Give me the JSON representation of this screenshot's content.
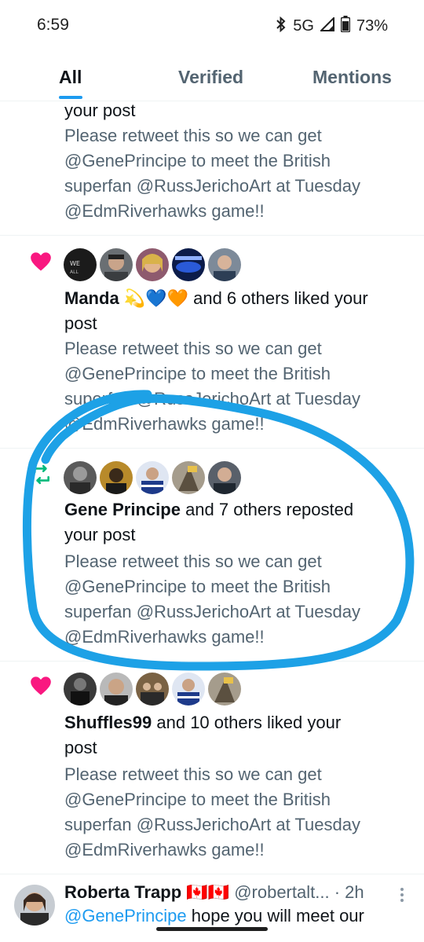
{
  "status": {
    "time": "6:59",
    "network": "5G",
    "battery": "73%"
  },
  "tabs": [
    {
      "label": "All",
      "active": true
    },
    {
      "label": "Verified",
      "active": false
    },
    {
      "label": "Mentions",
      "active": false
    }
  ],
  "post_text": [
    "Please retweet this so we can get",
    "@GenePrincipe to meet the British",
    "superfan @RussJerichoArt at Tuesday",
    "@EdmRiverhawks game!!"
  ],
  "notifications": [
    {
      "partial_header": "your post"
    },
    {
      "type": "like",
      "actor": "Manda",
      "actor_emoji": "💫💙🧡",
      "rest": " and 6 others liked your",
      "rest2": "post"
    },
    {
      "type": "repost",
      "actor": "Gene Principe",
      "rest": " and 7 others reposted",
      "rest2": "your post"
    },
    {
      "type": "like",
      "actor": "Shuffles99",
      "rest": " and 10 others liked your",
      "rest2": "post"
    }
  ],
  "bottom_tweet": {
    "name": "Roberta Trapp",
    "flags": "🇨🇦🇨🇦",
    "handle": "@robertalt...",
    "time": "· 2h",
    "text_mention": "@GenePrincipe",
    "text_rest": " hope you will meet our"
  },
  "colors": {
    "accent": "#1d9bf0",
    "like": "#f91880",
    "repost": "#00ba7c",
    "annotation": "#1da1e6"
  },
  "icons": [
    "heart-icon",
    "repost-icon",
    "more-options-icon",
    "wifi-signal-icon",
    "battery-icon",
    "bluetooth-icon"
  ]
}
